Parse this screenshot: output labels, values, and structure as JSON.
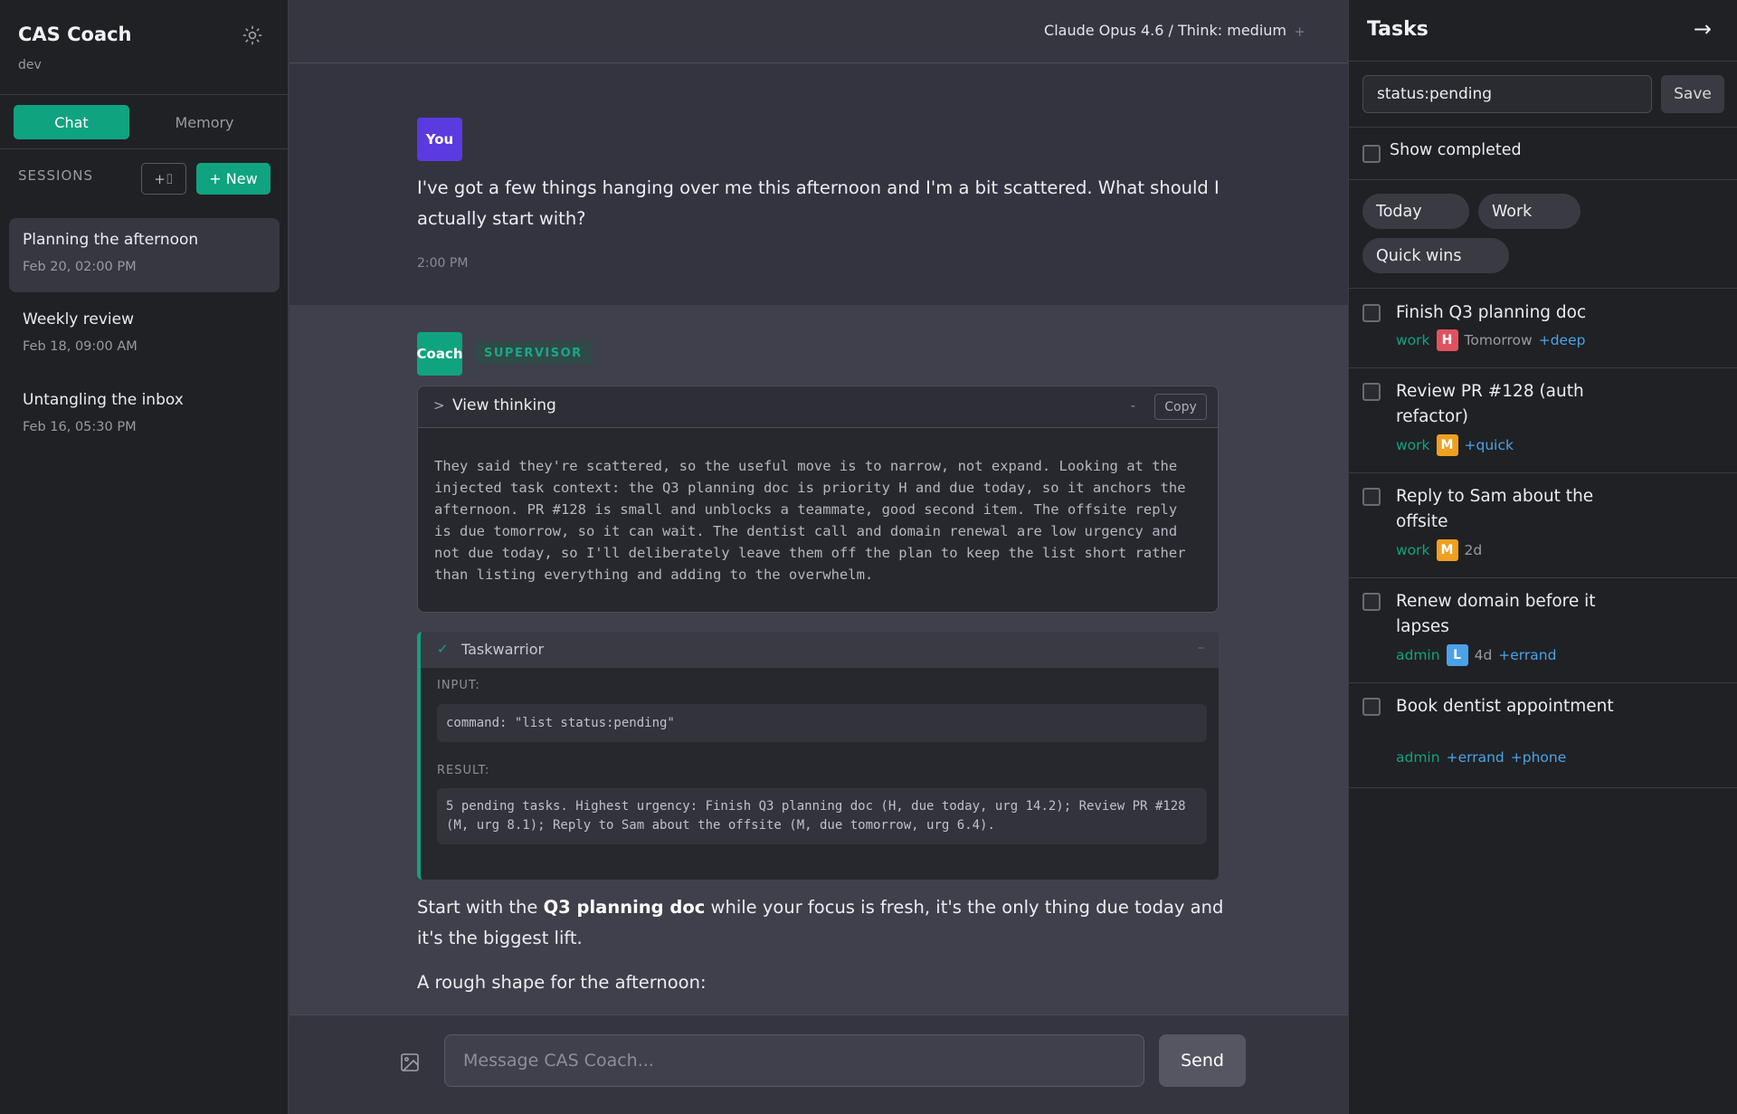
{
  "sidebar": {
    "app_title": "CAS Coach",
    "env": "dev",
    "tabs": {
      "chat": "Chat",
      "memory": "Memory"
    },
    "sessions_label": "SESSIONS",
    "icon_button_label": "+⌷",
    "new_button": "+ New",
    "sessions": [
      {
        "title": "Planning the afternoon",
        "date": "Feb 20, 02:00 PM"
      },
      {
        "title": "Weekly review",
        "date": "Feb 18, 09:00 AM"
      },
      {
        "title": "Untangling the inbox",
        "date": "Feb 16, 05:30 PM"
      }
    ]
  },
  "topbar": {
    "model": "Claude Opus 4.6 / Think: medium",
    "plus": "+"
  },
  "user_message": {
    "badge": "You",
    "text": "I've got a few things hanging over me this afternoon and I'm a bit scattered. What should I actually start with?",
    "time": "2:00 PM"
  },
  "coach": {
    "badge": "Coach",
    "role": "SUPERVISOR",
    "thinking": {
      "chevron": ">",
      "title": "View thinking",
      "dash": "-",
      "copy": "Copy",
      "text": "They said they're scattered, so the useful move is to narrow, not expand. Looking at the injected task context: the Q3 planning doc is priority H and due today, so it anchors the afternoon. PR #128 is small and unblocks a teammate, good second item. The offsite reply is due tomorrow, so it can wait. The dentist call and domain renewal are low urgency and not due today, so I'll deliberately leave them off the plan to keep the list short rather than listing everything and adding to the overwhelm."
    },
    "tool": {
      "check": "✓",
      "name": "Taskwarrior",
      "minimize": "–",
      "input_label": "INPUT:",
      "input": "command: \"list status:pending\"",
      "result_label": "RESULT:",
      "result": "5 pending tasks. Highest urgency: Finish Q3 planning doc (H, due today, urg 14.2); Review PR #128 (M, urg 8.1); Reply to Sam about the offsite (M, due tomorrow, urg 6.4)."
    },
    "answer": {
      "p1_pre": "Start with the ",
      "p1_bold": "Q3 planning doc",
      "p1_post": " while your focus is fresh, it's the only thing due today and it's the biggest lift.",
      "p2": "A rough shape for the afternoon:"
    }
  },
  "composer": {
    "placeholder": "Message CAS Coach...",
    "send": "Send"
  },
  "tasks_panel": {
    "title": "Tasks",
    "close_arrow": "→",
    "filter_value": "status:pending",
    "save": "Save",
    "show_completed": "Show completed",
    "chips": [
      "Today",
      "Work",
      "Quick wins"
    ],
    "items": [
      {
        "title": "Finish Q3 planning doc",
        "project": "work",
        "priority": "H",
        "priority_color": "#e05260",
        "due": "Tomorrow",
        "tags": [
          "+deep"
        ]
      },
      {
        "title": "Review PR #128 (auth refactor)",
        "project": "work",
        "priority": "M",
        "priority_color": "#f0a020",
        "due": "",
        "tags": [
          "+quick"
        ]
      },
      {
        "title": "Reply to Sam about the offsite",
        "project": "work",
        "priority": "M",
        "priority_color": "#f0a020",
        "due": "2d",
        "tags": []
      },
      {
        "title": "Renew domain before it lapses",
        "project": "admin",
        "priority": "L",
        "priority_color": "#4aa3e8",
        "due": "4d",
        "tags": [
          "+errand"
        ]
      },
      {
        "title": "Book dentist appointment",
        "project": "admin",
        "priority": "",
        "priority_color": "",
        "due": "",
        "tags": [
          "+errand",
          "+phone"
        ]
      }
    ]
  },
  "colors": {
    "accent": "#10a37f",
    "user_badge": "#5b3ae0",
    "tag": "#4aa3e8"
  }
}
